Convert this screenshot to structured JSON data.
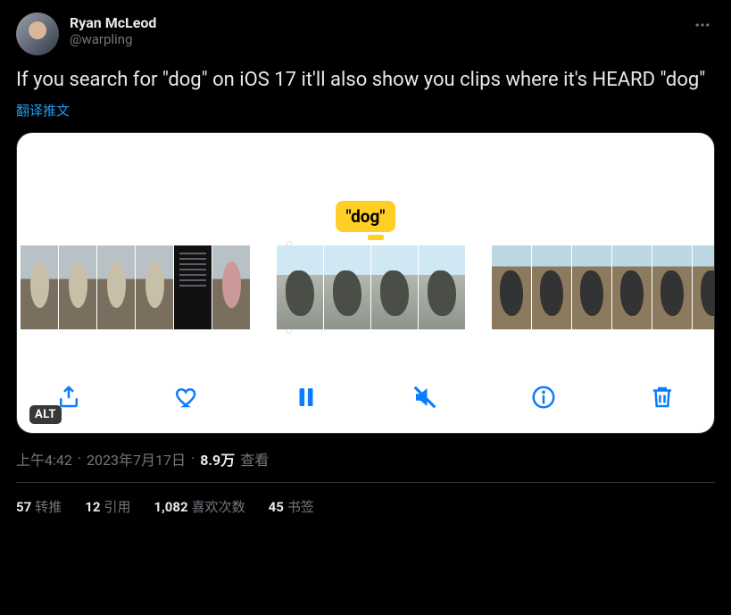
{
  "author": {
    "display_name": "Ryan McLeod",
    "handle": "@warpling"
  },
  "text": "If you search for \"dog\" on iOS 17 it'll also show you clips where it's HEARD \"dog\"",
  "translate_label": "翻译推文",
  "media": {
    "highlight_word": "\"dog\"",
    "alt_badge": "ALT"
  },
  "meta": {
    "time": "上午4:42",
    "date": "2023年7月17日",
    "views_number": "8.9万",
    "views_label": "查看",
    "separator": "·"
  },
  "engagement": {
    "retweets": {
      "count": "57",
      "label": "转推"
    },
    "quotes": {
      "count": "12",
      "label": "引用"
    },
    "likes": {
      "count": "1,082",
      "label": "喜欢次数"
    },
    "bookmarks": {
      "count": "45",
      "label": "书签"
    }
  }
}
